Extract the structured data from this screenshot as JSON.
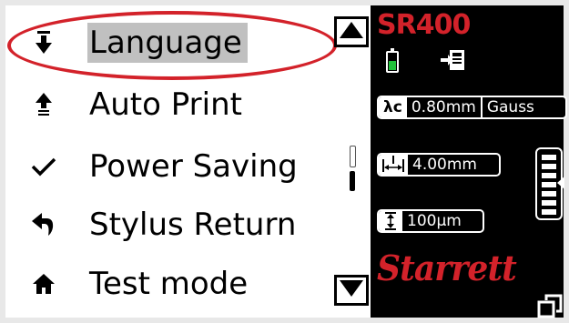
{
  "device": {
    "model": "SR400",
    "brand": "Starrett",
    "colors": {
      "accent": "#d3222a",
      "battery": "#21c13a",
      "selected_bg": "#c0c0c0"
    }
  },
  "menu": {
    "items": [
      {
        "label": "Language",
        "icon": "down-arrow-icon",
        "selected": true
      },
      {
        "label": "Auto Print",
        "icon": "up-arrow-icon",
        "selected": false
      },
      {
        "label": "Power Saving",
        "icon": "checkmark-icon",
        "selected": false
      },
      {
        "label": "Stylus Return",
        "icon": "return-arrow-icon",
        "selected": false
      },
      {
        "label": "Test mode",
        "icon": "home-icon",
        "selected": false
      }
    ],
    "scroll_up_icon": "triangle-up-icon",
    "scroll_down_icon": "triangle-down-icon"
  },
  "status": {
    "battery_level": 0.5,
    "cutoff": {
      "symbol": "λc",
      "value": "0.80mm",
      "filter": "Gauss"
    },
    "evaluation_length": {
      "icon": "evaluation-length-icon",
      "value": "4.00mm"
    },
    "measuring_range": {
      "icon": "range-icon",
      "value": "100µm"
    }
  }
}
